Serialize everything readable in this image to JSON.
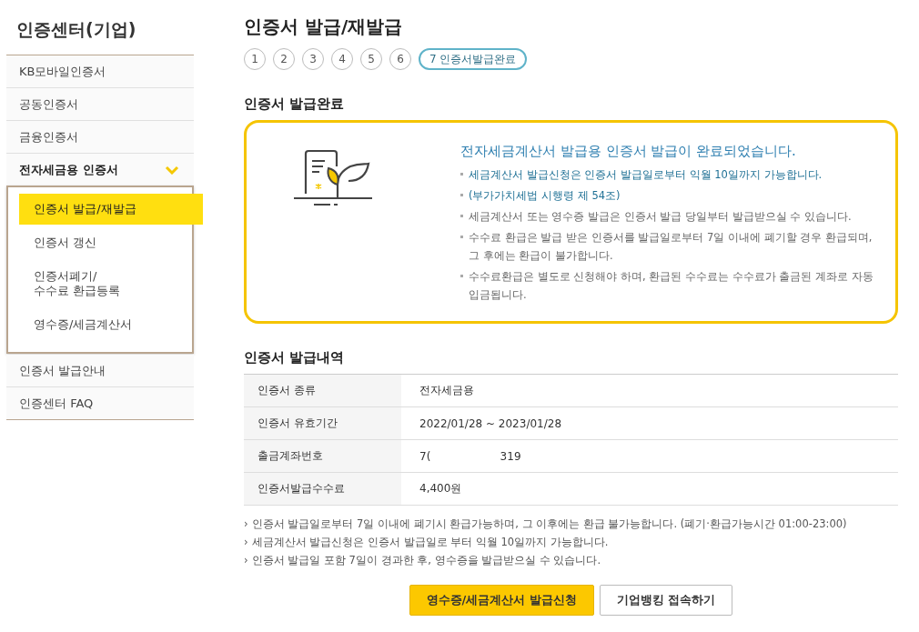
{
  "sidebar": {
    "title": "인증센터(기업)",
    "items": [
      {
        "label": "KB모바일인증서",
        "expanded": false
      },
      {
        "label": "공동인증서",
        "expanded": false
      },
      {
        "label": "금융인증서",
        "expanded": false
      },
      {
        "label": "전자세금용 인증서",
        "expanded": true,
        "children": [
          {
            "label": "인증서 발급/재발급",
            "selected": true
          },
          {
            "label": "인증서 갱신",
            "selected": false
          },
          {
            "label": "인증서폐기/\n수수료 환급등록",
            "selected": false
          },
          {
            "label": "영수증/세금계산서",
            "selected": false
          }
        ]
      },
      {
        "label": "인증서 발급안내",
        "expanded": false
      },
      {
        "label": "인증센터 FAQ",
        "expanded": false
      }
    ]
  },
  "page_title": "인증서 발급/재발급",
  "steps": [
    {
      "label": "1",
      "selected": false
    },
    {
      "label": "2",
      "selected": false
    },
    {
      "label": "3",
      "selected": false
    },
    {
      "label": "4",
      "selected": false
    },
    {
      "label": "5",
      "selected": false
    },
    {
      "label": "6",
      "selected": false
    },
    {
      "label": "7 인증서발급완료",
      "selected": true
    }
  ],
  "complete_section": {
    "heading": "인증서 발급완료",
    "message": "전자세금계산서 발급용 인증서 발급이 완료되었습니다.",
    "bullets": [
      {
        "text": "세금계산서 발급신청은 인증서 발급일로부터 익월 10일까지 가능합니다.",
        "emphasis": true
      },
      {
        "text": "(부가가치세법 시행령 제 54조)",
        "emphasis": true
      },
      {
        "text": "세금계산서 또는 영수증 발급은 인증서 발급 당일부터 발급받으실 수 있습니다.",
        "emphasis": false
      },
      {
        "text": "수수료 환급은 발급 받은 인증서를 발급일로부터 7일 이내에 폐기할 경우 환급되며, 그 후에는 환급이 불가합니다.",
        "emphasis": false
      },
      {
        "text": "수수료환급은 별도로 신청해야 하며, 환급된 수수료는 수수료가 출금된 계좌로 자동입금됩니다.",
        "emphasis": false
      }
    ]
  },
  "history_section": {
    "heading": "인증서 발급내역",
    "rows": [
      {
        "label": "인증서 종류",
        "value": "전자세금용"
      },
      {
        "label": "인증서 유효기간",
        "value": "2022/01/28 ~ 2023/01/28"
      },
      {
        "label": "출금계좌번호",
        "value": "7(                    319"
      },
      {
        "label": "인증서발급수수료",
        "value": "4,400원"
      }
    ]
  },
  "notes": [
    {
      "marker": "›",
      "text": "인증서 발급일로부터 7일 이내에 폐기시 환급가능하며, 그 이후에는 환급 불가능합니다. (폐기·환급가능시간 01:00-23:00)"
    },
    {
      "marker": "›",
      "text": "세금계산서 발급신청은 인증서 발급일로 부터 익월 10일까지 가능합니다."
    },
    {
      "marker": "›",
      "text": "인증서 발급일 포함 7일이 경과한 후, 영수증을 발급받으실 수 있습니다."
    }
  ],
  "buttons": [
    {
      "label": "영수증/세금계산서 발급신청",
      "kind": "primary"
    },
    {
      "label": "기업뱅킹 접속하기",
      "kind": "secondary"
    }
  ]
}
